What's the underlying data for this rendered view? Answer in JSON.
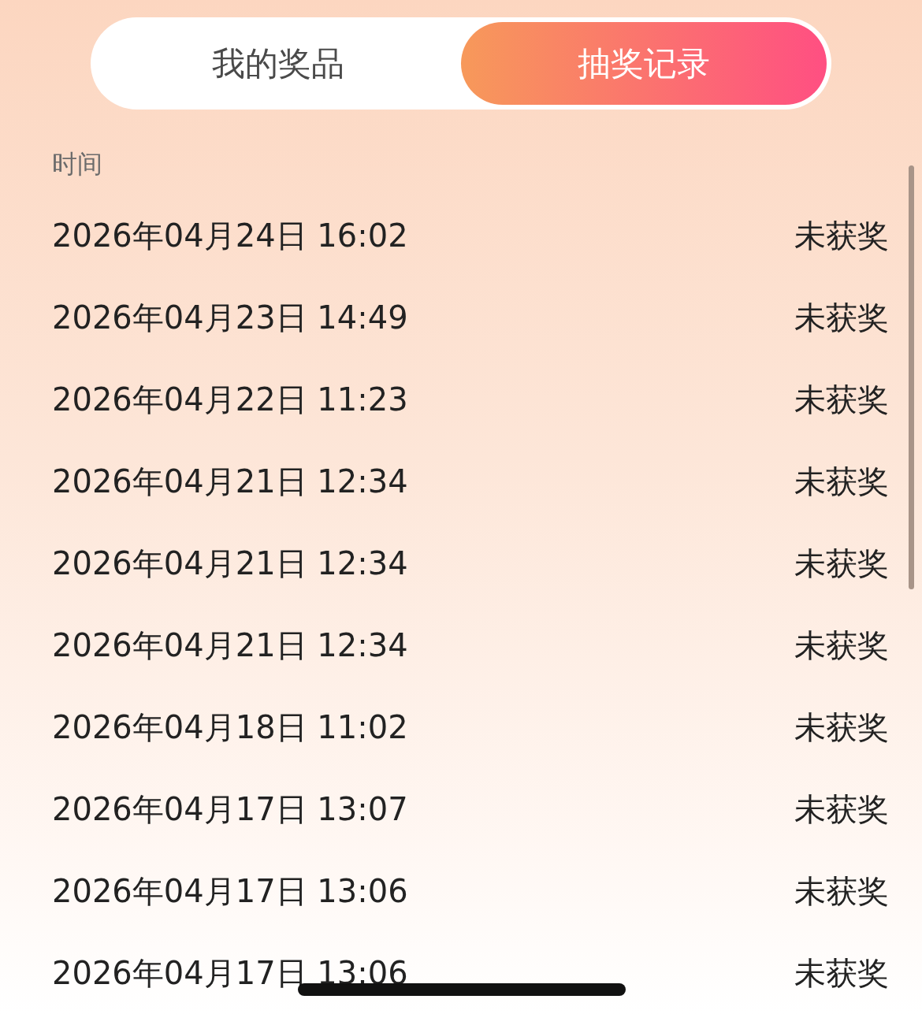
{
  "tabs": [
    {
      "label": "我的奖品",
      "selected": false
    },
    {
      "label": "抽奖记录",
      "selected": true
    }
  ],
  "list": {
    "header": "时间",
    "rows": [
      {
        "time": "2026年04月24日 16:02",
        "status": "未获奖"
      },
      {
        "time": "2026年04月23日 14:49",
        "status": "未获奖"
      },
      {
        "time": "2026年04月22日 11:23",
        "status": "未获奖"
      },
      {
        "time": "2026年04月21日 12:34",
        "status": "未获奖"
      },
      {
        "time": "2026年04月21日 12:34",
        "status": "未获奖"
      },
      {
        "time": "2026年04月21日 12:34",
        "status": "未获奖"
      },
      {
        "time": "2026年04月18日 11:02",
        "status": "未获奖"
      },
      {
        "time": "2026年04月17日 13:07",
        "status": "未获奖"
      },
      {
        "time": "2026年04月17日 13:06",
        "status": "未获奖"
      },
      {
        "time": "2026年04月17日 13:06",
        "status": "未获奖"
      }
    ]
  }
}
